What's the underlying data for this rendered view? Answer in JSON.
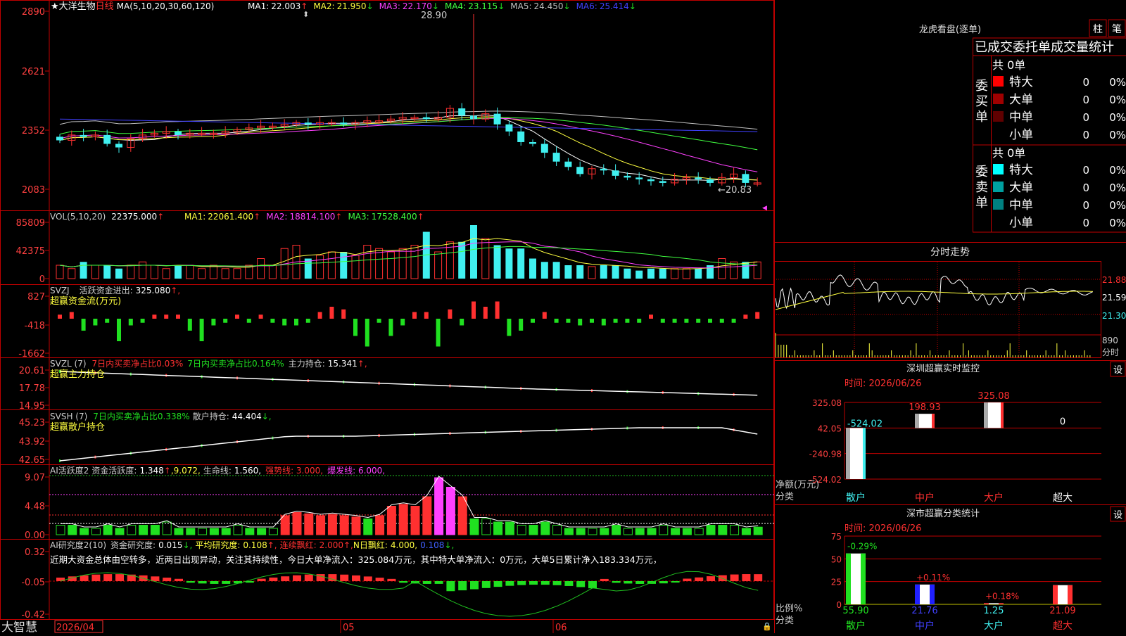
{
  "stock": {
    "name": "大洋生物",
    "period": "日线",
    "star": "★"
  },
  "colors": {
    "up": "#ff3030",
    "down": "#40f0f0",
    "ma1": "#ffffff",
    "ma2": "#ffff40",
    "ma3": "#ff40ff",
    "ma4": "#40ff40",
    "ma5": "#c0c0c0",
    "ma6": "#4040ff",
    "green": "#20e020",
    "grid": "#c00000",
    "axisText": "#ff4040"
  },
  "price_panel": {
    "ma_label": "MA(5,10,20,30,60,120)",
    "legend": [
      {
        "k": "MA1:",
        "v": "22.003",
        "dir": "↑",
        "color": "#ffffff"
      },
      {
        "k": "MA2:",
        "v": "21.950",
        "dir": "↓",
        "color": "#ffff40"
      },
      {
        "k": "MA3:",
        "v": "22.170",
        "dir": "↓",
        "color": "#ff40ff"
      },
      {
        "k": "MA4:",
        "v": "23.115",
        "dir": "↓",
        "color": "#40ff40"
      },
      {
        "k": "MA5:",
        "v": "24.450",
        "dir": "↓",
        "color": "#c0c0c0"
      },
      {
        "k": "MA6:",
        "v": "25.414",
        "dir": "↓",
        "color": "#4040ff"
      }
    ],
    "yticks": [
      "2890",
      "2621",
      "2352",
      "2083"
    ],
    "high_label": "28.90",
    "low_label": "←20.83"
  },
  "vol_panel": {
    "label": "VOL(5,10,20)",
    "value": "22375.000",
    "dir": "↑",
    "legend": [
      {
        "k": "MA1:",
        "v": "22061.400",
        "dir": "↑",
        "color": "#ffff40"
      },
      {
        "k": "MA2:",
        "v": "18814.100",
        "dir": "↑",
        "color": "#ff40ff"
      },
      {
        "k": "MA3:",
        "v": "17528.400",
        "dir": "↑",
        "color": "#40ff40"
      }
    ],
    "yticks": [
      "85809",
      "42375",
      "0"
    ]
  },
  "svzj_panel": {
    "label": "SVZJ",
    "item": "活跃资金进出:",
    "value": "325.080",
    "dir": "↑,",
    "subtitle": "超赢资金流(万元)",
    "yticks": [
      "827",
      "-418",
      "-1662"
    ]
  },
  "svzl_panel": {
    "label": "SVZL (7)",
    "t1": "7日内买卖净占比0.03%",
    "t2": "7日内买卖净占比0.164%",
    "t3": "主力持仓:",
    "v3": "15.341",
    "dir": "↑,",
    "subtitle": "超赢主力持仓",
    "yticks": [
      "20.61",
      "17.78",
      "14.95"
    ]
  },
  "svsh_panel": {
    "label": "SVSH (7)",
    "t1": "7日内买卖净占比0.338%",
    "t2": "散户持仓:",
    "v2": "44.404",
    "dir": "↓,",
    "subtitle": "超赢散户持仓",
    "yticks": [
      "45.23",
      "43.92",
      "42.65"
    ]
  },
  "ai_panel": {
    "label": "AI活跃度2",
    "item": "资金活跃度:",
    "value": "1.348",
    "dir": "↑",
    "v2": ",9.072,",
    "t3": "生命线:",
    "v3": "1.560,",
    "t4": "强势线: 3.000,",
    "t5": "爆发线: 6.000,",
    "yticks": [
      "9.07",
      "4.48",
      "0.00"
    ]
  },
  "research_panel": {
    "label": "AI研究度2(10)",
    "item": "资金研究度:",
    "value": "0.015",
    "dir": "↓,",
    "t2": "平均研究度:",
    "v2": "0.108",
    "d2": "↑,",
    "t3": "连续飘红:",
    "v3": "2.000",
    "d3": "↑,",
    "t4": "N日飘红:",
    "v4": "4.000,",
    "v5": "0.108",
    "d5": "↓,",
    "note": "近期大资金总体由空转多，近两日出现异动，关注其持续性，今日大单净流入：325.084万元，其中特大单净流入：0万元，大单5日累计净入183.334万元，",
    "yticks": [
      "0.32",
      "-0.05",
      "-0.42"
    ]
  },
  "bottom_bar": {
    "app": "大智慧",
    "date": "2026/04",
    "m1": "05",
    "m2": "06"
  },
  "longhu": {
    "title": "龙虎看盘(逐单)",
    "btn1": "柱",
    "btn2": "笔",
    "header": "已成交委托单成交量统计",
    "buy_label": "委买单",
    "sell_label": "委卖单",
    "buy_total": "共 0单",
    "sell_total": "共 0单",
    "buy_rows": [
      {
        "name": "特大",
        "v": "0",
        "p": "0%",
        "color": "#ff0000"
      },
      {
        "name": "大单",
        "v": "0",
        "p": "0%",
        "color": "#a00000"
      },
      {
        "name": "中单",
        "v": "0",
        "p": "0%",
        "color": "#600000"
      },
      {
        "name": "小单",
        "v": "0",
        "p": "0%",
        "color": ""
      }
    ],
    "sell_rows": [
      {
        "name": "特大",
        "v": "0",
        "p": "0%",
        "color": "#00ffff"
      },
      {
        "name": "大单",
        "v": "0",
        "p": "0%",
        "color": "#00a0a0"
      },
      {
        "name": "中单",
        "v": "0",
        "p": "0%",
        "color": "#008080"
      },
      {
        "name": "小单",
        "v": "0",
        "p": "0%",
        "color": ""
      }
    ]
  },
  "fenshi": {
    "title": "分时走势",
    "yticks": [
      "21.88",
      "21.59",
      "21.30"
    ],
    "vol_ticks": [
      "890",
      "分时"
    ]
  },
  "sz_monitor": {
    "title": "深圳超赢实时监控",
    "btn": "设",
    "time": "时间: 2026/06/26",
    "yticks": [
      "325.08",
      "42.05",
      "-240.98",
      "-524.02"
    ],
    "unit": "净额(万元)",
    "cat_label": "分类",
    "bars": [
      {
        "cat": "散户",
        "value": -524.02,
        "label": "-524.02",
        "color": "#40f0f0",
        "label_color": "#40f0f0",
        "cat_color": "#40f0f0"
      },
      {
        "cat": "中户",
        "value": 198.93,
        "label": "198.93",
        "color": "#ff3030",
        "label_color": "#ff3030",
        "cat_color": "#ff3030"
      },
      {
        "cat": "大户",
        "value": 325.08,
        "label": "325.08",
        "color": "#ff3030",
        "label_color": "#ff3030",
        "cat_color": "#ff3030"
      },
      {
        "cat": "超大",
        "value": 0,
        "label": "0",
        "color": "#ffffff",
        "label_color": "#ffffff",
        "cat_color": "#ffffff"
      }
    ]
  },
  "sz_class": {
    "title": "深市超赢分类统计",
    "btn": "设",
    "time": "时间: 2026/06/26",
    "yticks": [
      "75",
      "50",
      "25",
      "0"
    ],
    "unit": "比例%",
    "cat_label": "分类",
    "bars": [
      {
        "cat": "散户",
        "value": 55.9,
        "label": "55.90",
        "chg": "-0.29%",
        "color": "#20e020",
        "chg_color": "#20e020",
        "label_color": "#20e020",
        "cat_color": "#20e020"
      },
      {
        "cat": "中户",
        "value": 21.76,
        "label": "21.76",
        "chg": "+0.11%",
        "color": "#2020ff",
        "chg_color": "#ff3030",
        "label_color": "#4040ff",
        "cat_color": "#4040ff"
      },
      {
        "cat": "大户",
        "value": 1.25,
        "label": "1.25",
        "chg": "+0.18%",
        "color": "#ff3030",
        "chg_color": "#ff3030",
        "label_color": "#40f0f0",
        "cat_color": "#40f0f0"
      },
      {
        "cat": "超大",
        "value": 21.09,
        "label": "21.09",
        "chg": "",
        "color": "#ff3030",
        "chg_color": "#ff3030",
        "label_color": "#ff3030",
        "cat_color": "#ff3030"
      }
    ]
  },
  "chart_data": {
    "type": "bar",
    "title": "深圳超赢实时监控",
    "categories": [
      "散户",
      "中户",
      "大户",
      "超大"
    ],
    "values": [
      -524.02,
      198.93,
      325.08,
      0
    ],
    "ylabel": "净额(万元)",
    "ylim": [
      -524.02,
      325.08
    ]
  }
}
